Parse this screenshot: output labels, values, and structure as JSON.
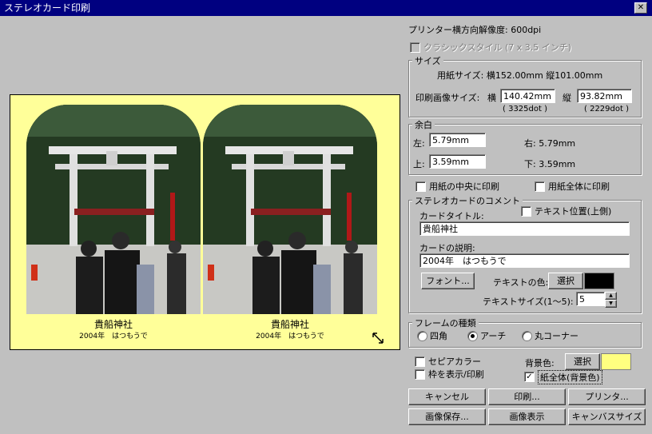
{
  "window": {
    "title": "ステレオカード印刷",
    "close_label": "✕"
  },
  "printer_resolution": "プリンター横方向解像度: 600dpi",
  "classic_style": {
    "label": "クラシックスタイル (7 x 3.5 インチ)",
    "checked": false,
    "disabled": true
  },
  "size": {
    "legend": "サイズ",
    "paper_size_text": "用紙サイズ: 横152.00mm 縦101.00mm",
    "print_size_label": "印刷画像サイズ:",
    "width_label": "横",
    "width_value": "140.42mm",
    "width_dots": "( 3325dot )",
    "height_label": "縦",
    "height_value": "93.82mm",
    "height_dots": "( 2229dot )"
  },
  "margin": {
    "legend": "余白",
    "left_label": "左:",
    "left_value": "5.79mm",
    "top_label": "上:",
    "top_value": "3.59mm",
    "right_text": "右: 5.79mm",
    "bottom_text": "下: 3.59mm"
  },
  "center_print": {
    "label": "用紙の中央に印刷",
    "checked": false
  },
  "full_print": {
    "label": "用紙全体に印刷",
    "checked": false
  },
  "comment": {
    "legend": "ステレオカードのコメント",
    "title_label": "カードタイトル:",
    "text_position_label": "テキスト位置(上側)",
    "text_position_checked": false,
    "title_value": "貴船神社",
    "desc_label": "カードの説明:",
    "desc_value": "2004年　はつもうで",
    "font_button": "フォント...",
    "text_color_label": "テキストの色:",
    "text_color_select": "選択",
    "text_color": "#000000",
    "text_size_label": "テキストサイズ(1〜5):",
    "text_size_value": "5"
  },
  "frame": {
    "legend": "フレームの種類",
    "options": [
      "四角",
      "アーチ",
      "丸コーナー"
    ],
    "selected": "アーチ"
  },
  "sepia": {
    "label": "セピアカラー",
    "checked": false
  },
  "show_frame": {
    "label": "枠を表示/印刷",
    "checked": false
  },
  "background": {
    "label": "背景色:",
    "select": "選択",
    "color": "#ffff80",
    "whole_paper_label": "紙全体(背景色)",
    "whole_paper_checked": true
  },
  "buttons": {
    "cancel": "キャンセル",
    "print": "印刷...",
    "printer": "プリンタ...",
    "save_image": "画像保存...",
    "show_image": "画像表示",
    "canvas_size": "キャンバスサイズ"
  },
  "preview": {
    "background": "#ffff99",
    "left_caption_title": "貴船神社",
    "left_caption_desc": "2004年　はつもうで",
    "right_caption_title": "貴船神社",
    "right_caption_desc": "2004年　はつもうで"
  }
}
